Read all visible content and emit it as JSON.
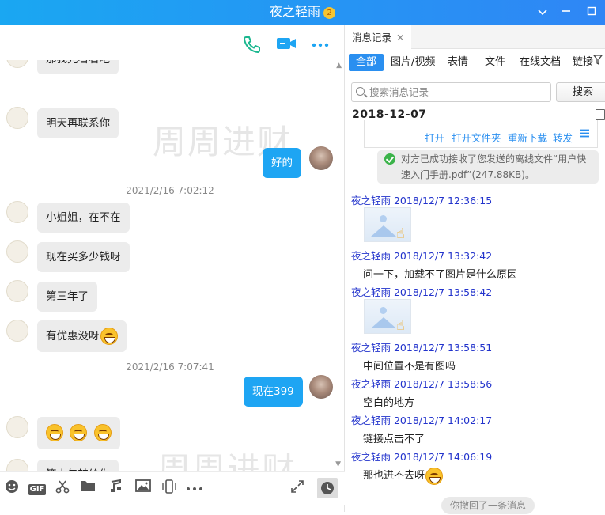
{
  "window": {
    "title": "夜之轻雨",
    "vip_badge": "2"
  },
  "chat": {
    "watermark": "周周进财",
    "messages": [
      {
        "side": "in",
        "text": "那我先看看吧",
        "partial": true
      },
      {
        "side": "in",
        "text": "明天再联系你"
      },
      {
        "side": "out",
        "text": "好的"
      },
      {
        "type": "time",
        "text": "2021/2/16 7:02:12"
      },
      {
        "side": "in",
        "text": "小姐姐，在不在"
      },
      {
        "side": "in",
        "text": "现在买多少钱呀"
      },
      {
        "side": "in",
        "text": "第三年了"
      },
      {
        "side": "in",
        "text": "有优惠没呀"
      },
      {
        "type": "time",
        "text": "2021/2/16 7:07:41"
      },
      {
        "side": "out",
        "text": "现在399"
      },
      {
        "side": "in",
        "text": "",
        "emojis": 3
      },
      {
        "side": "in",
        "text": "等中午转给你"
      }
    ],
    "input_toolbar": {
      "gif_label": "GIF"
    }
  },
  "history": {
    "tab_label": "消息记录",
    "filters": [
      "全部",
      "图片/视频",
      "表情",
      "文件",
      "在线文档",
      "链接"
    ],
    "active_filter": "全部",
    "search": {
      "placeholder": "搜索消息记录",
      "button": "搜索"
    },
    "date": "2018-12-07",
    "file_actions": [
      "打开",
      "打开文件夹",
      "重新下载",
      "转发"
    ],
    "notice": "对方已成功接收了您发送的离线文件“用户快速入门手册.pdf”(247.88KB)。",
    "entries": [
      {
        "meta": "夜之轻雨 2018/12/7 12:36:15",
        "image": true
      },
      {
        "meta": "夜之轻雨 2018/12/7 13:32:42",
        "text": "问一下，加载不了图片是什么原因"
      },
      {
        "meta": "夜之轻雨 2018/12/7 13:58:42",
        "image": true
      },
      {
        "meta": "夜之轻雨 2018/12/7 13:58:51",
        "text": "中间位置不是有图吗"
      },
      {
        "meta": "夜之轻雨 2018/12/7 13:58:56",
        "text": "空白的地方"
      },
      {
        "meta": "夜之轻雨 2018/12/7 14:02:17",
        "text": "链接点击不了"
      },
      {
        "meta": "夜之轻雨 2018/12/7 14:06:19",
        "text": "那也进不去呀"
      }
    ],
    "recall": "你撤回了一条消息"
  },
  "colors": {
    "accent": "#1ea5f3",
    "meta_blue": "#2233cc",
    "link_blue": "#2a8ff0",
    "phone_green": "#1bb78f"
  }
}
